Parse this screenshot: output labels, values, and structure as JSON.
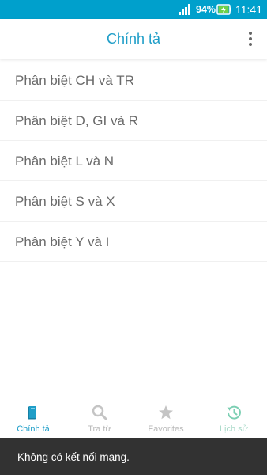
{
  "status_bar": {
    "battery": "94%",
    "time": "11:41"
  },
  "app_bar": {
    "title": "Chính tả",
    "menu_icon": "more-vert-icon"
  },
  "list": {
    "items": [
      {
        "label": "Phân biệt CH và TR"
      },
      {
        "label": "Phân biệt D, GI và R"
      },
      {
        "label": "Phân biệt L và N"
      },
      {
        "label": "Phân biệt S và X"
      },
      {
        "label": "Phân biệt Y và I"
      }
    ]
  },
  "bottom_nav": {
    "items": [
      {
        "label": "Chính tả",
        "icon": "book-icon",
        "active": true
      },
      {
        "label": "Tra từ",
        "icon": "search-icon"
      },
      {
        "label": "Favorites",
        "icon": "star-icon"
      },
      {
        "label": "Lịch sử",
        "icon": "history-icon"
      }
    ]
  },
  "snackbar": {
    "message": "Không có kết nối mạng."
  },
  "colors": {
    "status_bar": "#00a0cc",
    "accent": "#1f9ec8",
    "history_icon": "#7ccfb3"
  }
}
